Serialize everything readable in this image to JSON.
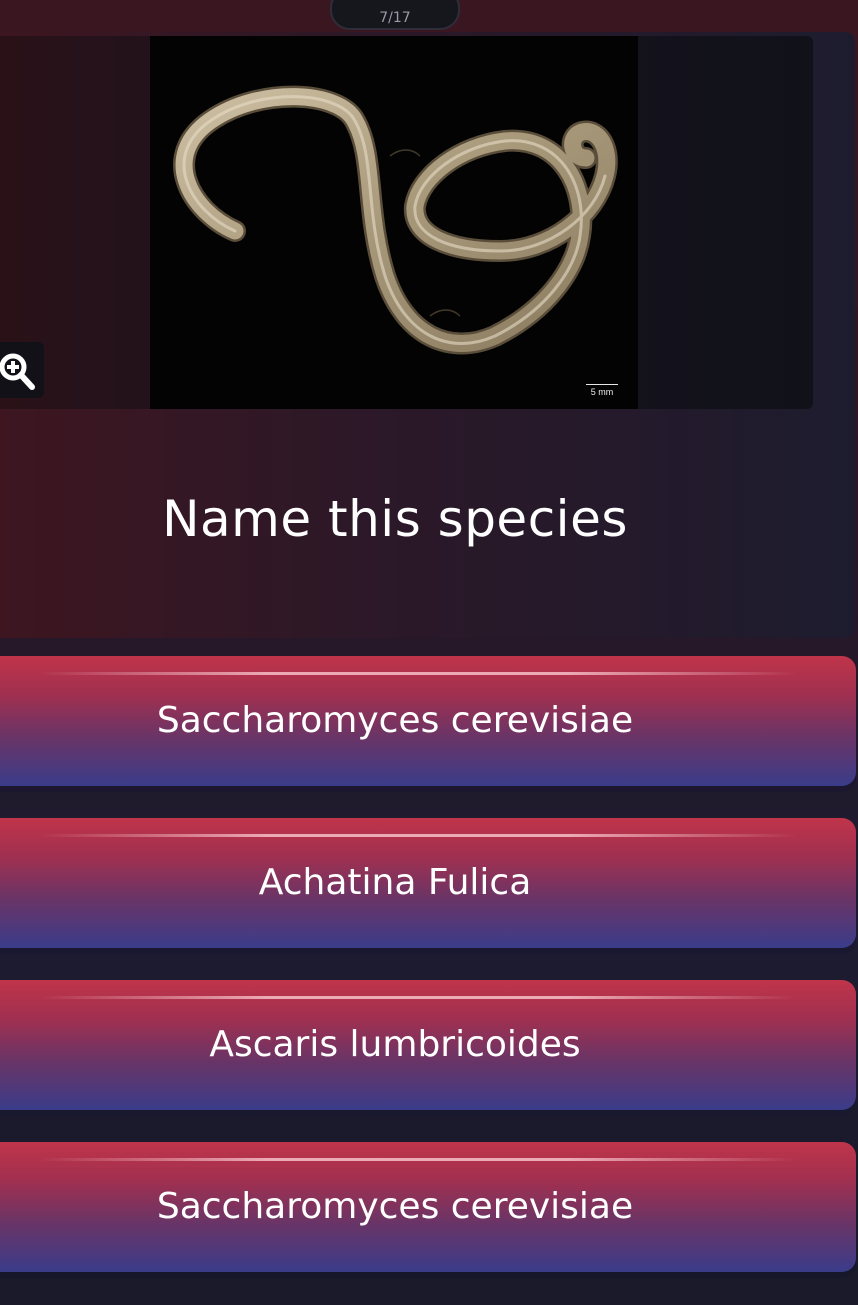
{
  "header": {
    "counter": "7/17"
  },
  "question": {
    "prompt": "Name this species",
    "image": {
      "subject": "roundworm-photo",
      "scale_label": "5 mm"
    },
    "zoom_icon": "zoom-in-icon"
  },
  "options": [
    {
      "label": "Saccharomyces cerevisiae"
    },
    {
      "label": "Achatina Fulica"
    },
    {
      "label": "Ascaris lumbricoides"
    },
    {
      "label": "Saccharomyces cerevisiae"
    }
  ],
  "colors": {
    "option_top": "#c0344a",
    "option_bottom": "#3a3c8a",
    "card_left": "#3d1620",
    "card_right": "#1d1c2e"
  }
}
